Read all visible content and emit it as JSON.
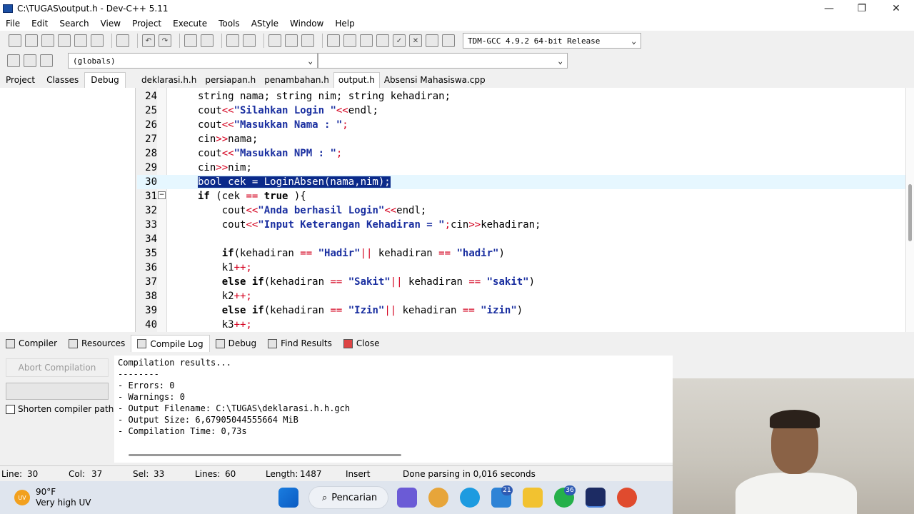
{
  "window": {
    "title": "C:\\TUGAS\\output.h - Dev-C++ 5.11",
    "minimize": "—",
    "maximize": "❐",
    "close": "✕"
  },
  "menu": [
    "File",
    "Edit",
    "Search",
    "View",
    "Project",
    "Execute",
    "Tools",
    "AStyle",
    "Window",
    "Help"
  ],
  "toolbar": {
    "compiler_select": "TDM-GCC 4.9.2 64-bit Release",
    "scope_select": "(globals)"
  },
  "panel_tabs": {
    "project": "Project",
    "classes": "Classes",
    "debug": "Debug"
  },
  "file_tabs": [
    "deklarasi.h.h",
    "persiapan.h",
    "penambahan.h",
    "output.h",
    "Absensi Mahasiswa.cpp"
  ],
  "editor": {
    "lines": [
      {
        "n": "24",
        "tokens": [
          [
            "",
            "string nama; string nim; string kehadiran;"
          ]
        ]
      },
      {
        "n": "25",
        "tokens": [
          [
            "",
            "cout"
          ],
          [
            "op",
            "<<"
          ],
          [
            "str",
            "\"Silahkan Login \""
          ],
          [
            "op",
            "<<"
          ],
          [
            "",
            "endl;"
          ]
        ]
      },
      {
        "n": "26",
        "tokens": [
          [
            "",
            "cout"
          ],
          [
            "op",
            "<<"
          ],
          [
            "str",
            "\"Masukkan Nama : \""
          ],
          [
            "op",
            ";"
          ]
        ]
      },
      {
        "n": "27",
        "tokens": [
          [
            "",
            "cin"
          ],
          [
            "op",
            ">>"
          ],
          [
            "",
            "nama;"
          ]
        ]
      },
      {
        "n": "28",
        "tokens": [
          [
            "",
            "cout"
          ],
          [
            "op",
            "<<"
          ],
          [
            "str",
            "\"Masukkan NPM : \""
          ],
          [
            "op",
            ";"
          ]
        ]
      },
      {
        "n": "29",
        "tokens": [
          [
            "",
            "cin"
          ],
          [
            "op",
            ">>"
          ],
          [
            "",
            "nim;"
          ]
        ]
      },
      {
        "n": "30",
        "tokens": [
          [
            "sel",
            "bool cek = LoginAbsen(nama,nim);"
          ]
        ]
      },
      {
        "n": "31",
        "tokens": [
          [
            "kw",
            "if"
          ],
          [
            "",
            " (cek "
          ],
          [
            "op",
            "=="
          ],
          [
            "kw",
            " true"
          ],
          [
            "",
            " ){"
          ]
        ]
      },
      {
        "n": "32",
        "tokens": [
          [
            "",
            "    cout"
          ],
          [
            "op",
            "<<"
          ],
          [
            "str",
            "\"Anda berhasil Login\""
          ],
          [
            "op",
            "<<"
          ],
          [
            "",
            "endl;"
          ]
        ]
      },
      {
        "n": "33",
        "tokens": [
          [
            "",
            "    cout"
          ],
          [
            "op",
            "<<"
          ],
          [
            "str",
            "\"Input Keterangan Kehadiran = \""
          ],
          [
            "op",
            ";"
          ],
          [
            "",
            "cin"
          ],
          [
            "op",
            ">>"
          ],
          [
            "",
            "kehadiran;"
          ]
        ]
      },
      {
        "n": "34",
        "tokens": []
      },
      {
        "n": "35",
        "tokens": [
          [
            "kw",
            "    if"
          ],
          [
            "",
            "(kehadiran "
          ],
          [
            "op",
            "=="
          ],
          [
            "str",
            " \"Hadir\""
          ],
          [
            "op",
            "||"
          ],
          [
            "",
            " kehadiran "
          ],
          [
            "op",
            "=="
          ],
          [
            "str",
            " \"hadir\""
          ],
          [
            "",
            ")"
          ]
        ]
      },
      {
        "n": "36",
        "tokens": [
          [
            "",
            "    k1"
          ],
          [
            "op",
            "++;"
          ]
        ]
      },
      {
        "n": "37",
        "tokens": [
          [
            "kw",
            "    else if"
          ],
          [
            "",
            "(kehadiran "
          ],
          [
            "op",
            "=="
          ],
          [
            "str",
            " \"Sakit\""
          ],
          [
            "op",
            "||"
          ],
          [
            "",
            " kehadiran "
          ],
          [
            "op",
            "=="
          ],
          [
            "str",
            " \"sakit\""
          ],
          [
            "",
            ")"
          ]
        ]
      },
      {
        "n": "38",
        "tokens": [
          [
            "",
            "    k2"
          ],
          [
            "op",
            "++;"
          ]
        ]
      },
      {
        "n": "39",
        "tokens": [
          [
            "kw",
            "    else if"
          ],
          [
            "",
            "(kehadiran "
          ],
          [
            "op",
            "=="
          ],
          [
            "str",
            " \"Izin\""
          ],
          [
            "op",
            "||"
          ],
          [
            "",
            " kehadiran "
          ],
          [
            "op",
            "=="
          ],
          [
            "str",
            " \"izin\""
          ],
          [
            "",
            ")"
          ]
        ]
      },
      {
        "n": "40",
        "tokens": [
          [
            "",
            "    k3"
          ],
          [
            "op",
            "++;"
          ]
        ]
      }
    ]
  },
  "bottom_tabs": {
    "compiler": "Compiler",
    "resources": "Resources",
    "compile_log": "Compile Log",
    "debug": "Debug",
    "find_results": "Find Results",
    "close": "Close"
  },
  "bottom_panel": {
    "abort_label": "Abort Compilation",
    "shorten_label": "Shorten compiler paths",
    "log_lines": [
      "Compilation results...",
      "--------",
      "- Errors: 0",
      "- Warnings: 0",
      "- Output Filename: C:\\TUGAS\\deklarasi.h.h.gch",
      "- Output Size: 6,67905044555664 MiB",
      "- Compilation Time: 0,73s"
    ]
  },
  "status": {
    "line": "Line:",
    "line_val": "30",
    "col": "Col:",
    "col_val": "37",
    "sel": "Sel:",
    "sel_val": "33",
    "lines": "Lines:",
    "lines_val": "60",
    "length": "Length:",
    "length_val": "1487",
    "mode": "Insert",
    "parse": "Done parsing in 0,016 seconds"
  },
  "taskbar": {
    "temp": "90°F",
    "uv": "Very high UV",
    "search": "Pencarian",
    "badge1": "21",
    "badge2": "36"
  }
}
